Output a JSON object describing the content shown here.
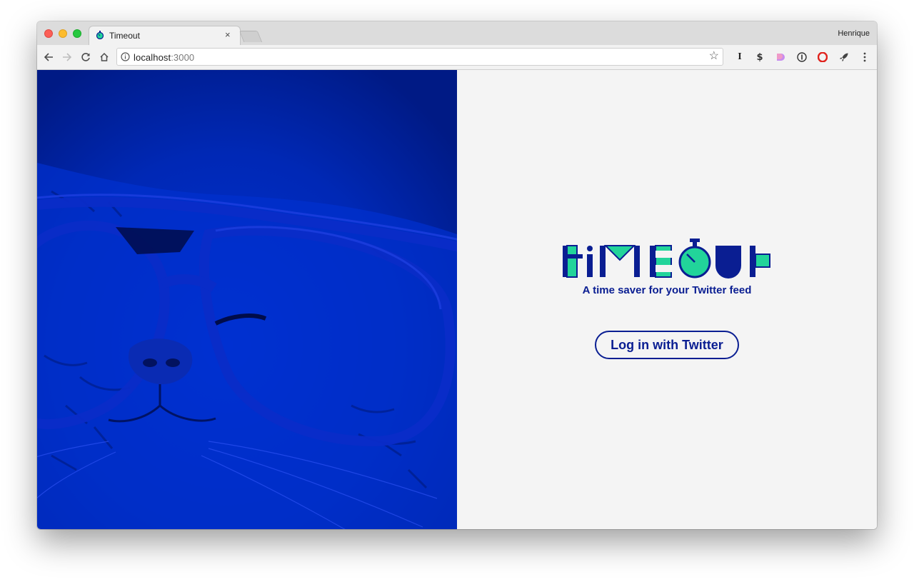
{
  "browser": {
    "tab_title": "Timeout",
    "tab_close": "×",
    "profile_name": "Henrique",
    "url_host": "localhost",
    "url_port": ":3000"
  },
  "toolbar_icons": [
    "back-arrow-icon",
    "forward-arrow-icon",
    "reload-icon",
    "home-icon",
    "info-icon",
    "bookmark-star-icon",
    "instapaper-icon",
    "extension-s-icon",
    "extension-pink-icon",
    "extension-1password-icon",
    "opera-icon",
    "rocket-icon",
    "menu-kebab-icon"
  ],
  "page": {
    "tagline": "A time saver for your Twitter feed",
    "login_button": "Log in with Twitter",
    "logo_alt": "timeout"
  },
  "colors": {
    "accent_blue": "#0a1e92",
    "accent_green": "#22d49a",
    "hero_blue": "#0026b8"
  }
}
